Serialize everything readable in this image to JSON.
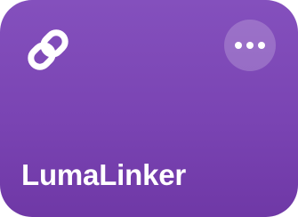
{
  "tile": {
    "title": "LumaLinker",
    "icon": "link-icon",
    "menu_icon": "more-options-icon",
    "background_color": "#7a44b3"
  }
}
